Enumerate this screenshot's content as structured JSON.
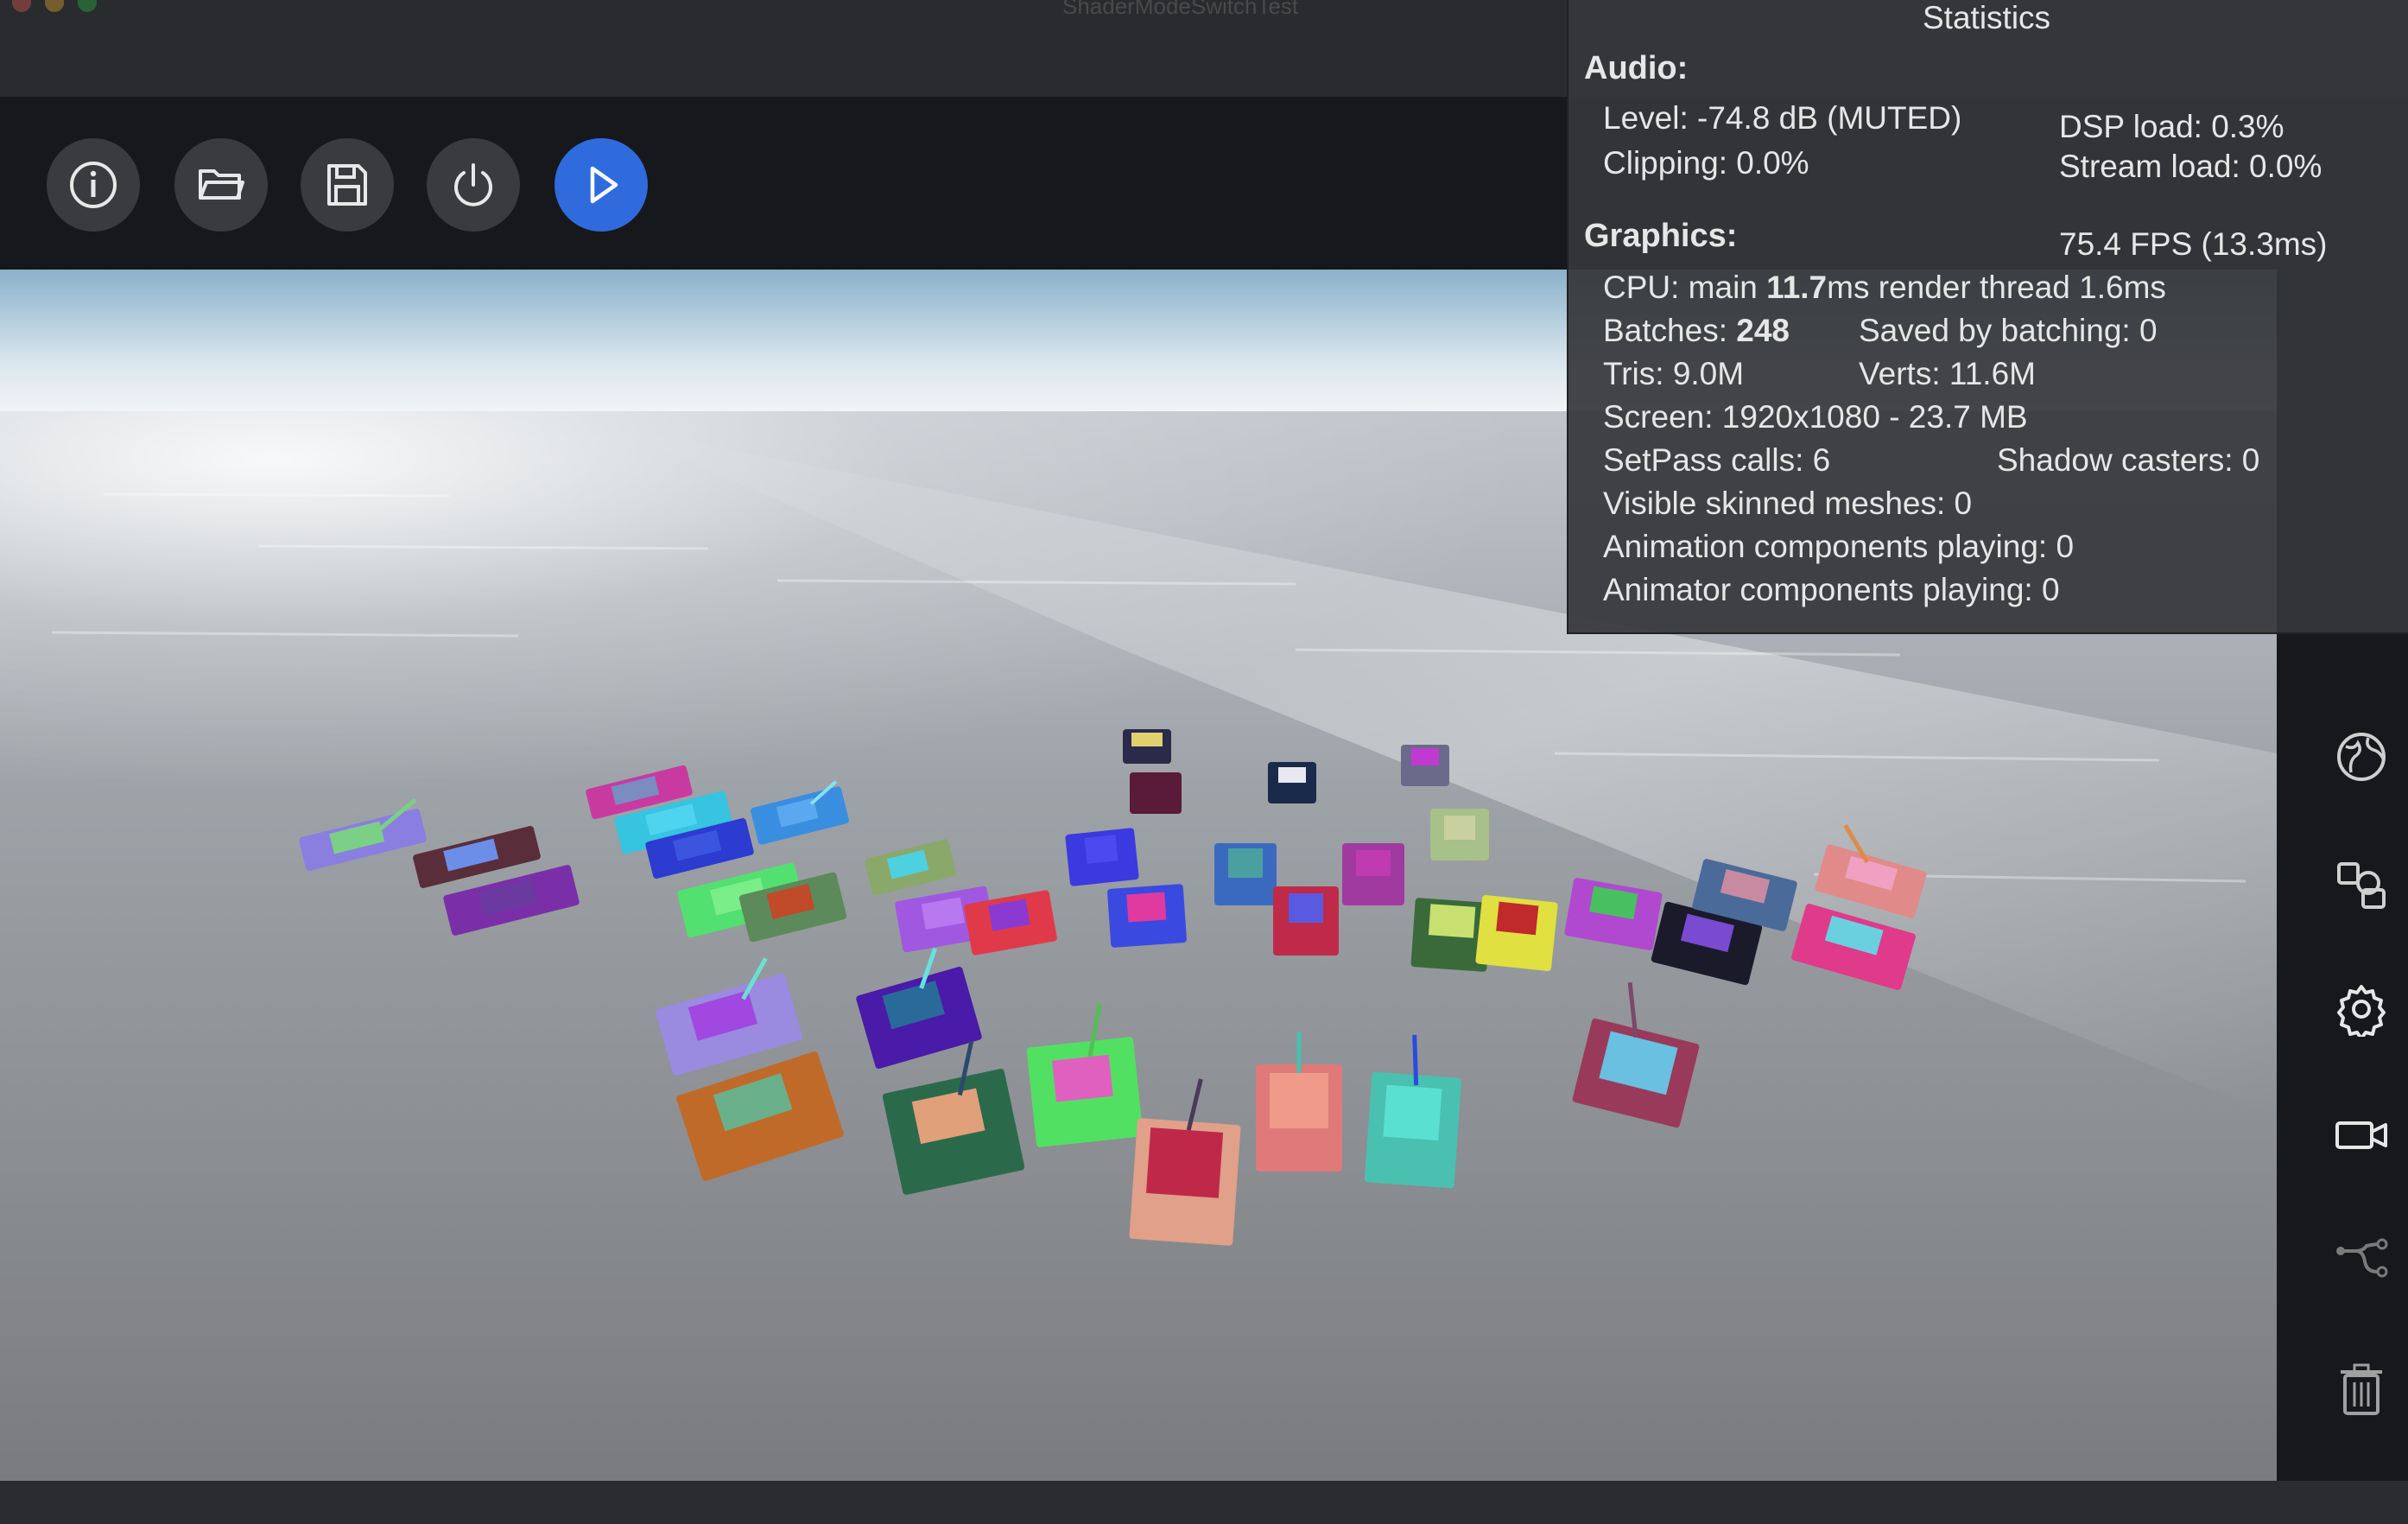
{
  "window": {
    "title": "ShaderModeSwitchTest"
  },
  "toolbar": {
    "buttons": [
      {
        "name": "info",
        "icon": "info-icon"
      },
      {
        "name": "open",
        "icon": "folder-open-icon"
      },
      {
        "name": "save",
        "icon": "save-icon"
      },
      {
        "name": "power",
        "icon": "power-icon"
      },
      {
        "name": "play",
        "icon": "play-icon",
        "color": "#2f6bdd"
      }
    ]
  },
  "statistics": {
    "title": "Statistics",
    "audio": {
      "heading": "Audio:",
      "level": "Level: -74.8 dB (MUTED)",
      "clipping": "Clipping: 0.0%",
      "dsp_load": "DSP load: 0.3%",
      "stream_load": "Stream load: 0.0%"
    },
    "graphics": {
      "heading": "Graphics:",
      "fps": "75.4 FPS (13.3ms)",
      "cpu_prefix": "CPU: main ",
      "cpu_main": "11.7",
      "cpu_suffix": "ms  render thread 1.6ms",
      "batches_prefix": "Batches: ",
      "batches": "248",
      "saved_by_batching": "Saved by batching: 0",
      "tris": "Tris: 9.0M",
      "verts": "Verts: 11.6M",
      "screen": "Screen: 1920x1080 - 23.7 MB",
      "setpass": "SetPass calls: 6",
      "shadow_casters": "Shadow casters: 0",
      "skinned": "Visible skinned meshes: 0",
      "animation": "Animation components playing: 0",
      "animator": "Animator components playing: 0"
    }
  },
  "sidebar": {
    "icons": [
      "globe-icon",
      "shapes-icon",
      "gear-icon",
      "camera-icon",
      "hierarchy-icon",
      "trash-icon"
    ]
  },
  "colors": {
    "accent": "#2f6bdd",
    "toolbar_bg": "#17181b",
    "panel_bg": "#36373a"
  }
}
